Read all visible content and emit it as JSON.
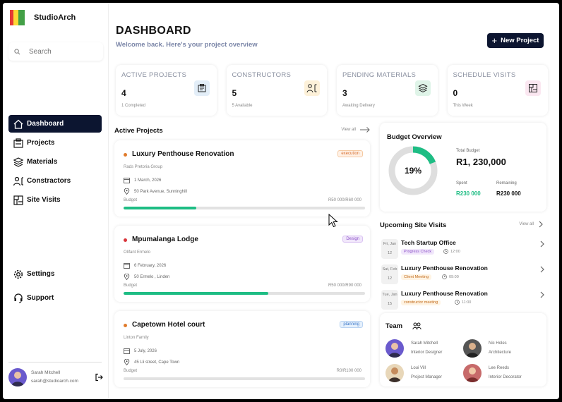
{
  "app": {
    "name": "StudioArch"
  },
  "search": {
    "placeholder": "Search"
  },
  "nav": [
    {
      "label": "Dashboard",
      "icon": "home-icon",
      "active": true
    },
    {
      "label": "Projects",
      "icon": "projects-icon"
    },
    {
      "label": "Materials",
      "icon": "layers-icon"
    },
    {
      "label": "Constractors",
      "icon": "constructor-icon"
    },
    {
      "label": "Site Visits",
      "icon": "blueprint-icon"
    }
  ],
  "footer_nav": {
    "settings": "Settings",
    "support": "Support"
  },
  "user": {
    "name": "Sarah Mitchell",
    "email": "sarah@studioarch.com"
  },
  "header": {
    "title": "DASHBOARD",
    "subtitle": "Welcome back. Here's your project overview",
    "new_button": "New Project"
  },
  "stats": [
    {
      "label": "ACTIVE PROJECTS",
      "value": "4",
      "sub": "1 Completed",
      "icon": "clipboard-icon",
      "color": "#e3eef8"
    },
    {
      "label": "CONSTRUCTORS",
      "value": "5",
      "sub": "5 Available",
      "icon": "worker-icon",
      "color": "#fdf1d9"
    },
    {
      "label": "PENDING MATERIALS",
      "value": "3",
      "sub": "Awaiting Delivery",
      "icon": "layers-icon",
      "color": "#dff4e8"
    },
    {
      "label": "SCHEDULE VISITS",
      "value": "0",
      "sub": "This Week",
      "icon": "blueprint-icon",
      "color": "#fbe7f1"
    }
  ],
  "active_projects": {
    "title": "Active Projects",
    "view_all": "View all",
    "items": [
      {
        "name": "Luxury Penthouse  Renovation",
        "tag": "execution",
        "client": "Rads Pretoria Group",
        "date": "1 March, 2026",
        "address": "50 Park Avenue, Sunninghill",
        "budget_label": "Budget",
        "amount": "R50 000/R60 000",
        "progress": 0.3,
        "dot": "#e07b2b",
        "tag_fg": "#d66a2a",
        "tag_bg": "#fff1e6"
      },
      {
        "name": "Mpumalanga Lodge",
        "tag": "Design",
        "client": "Olifant Ermelo",
        "date": "6 February, 2026",
        "address": "50 Ermelo , Linden",
        "budget_label": "Budget",
        "amount": "R50 000/R90 000",
        "progress": 0.6,
        "dot": "#d9343a",
        "tag_fg": "#8a4fc7",
        "tag_bg": "#f1e7fb"
      },
      {
        "name": "Capetown Hotel court",
        "tag": "planning",
        "client": "Linton Family",
        "date": "5 July, 2026",
        "address": "45 Lli street, Cape Town",
        "budget_label": "Budget",
        "amount": "R0/R100 000",
        "progress": 0,
        "dot": "#e07b2b",
        "tag_fg": "#3a76c9",
        "tag_bg": "#e5f0fc"
      }
    ]
  },
  "budget": {
    "title": "Budget Overview",
    "percent": "19%",
    "percent_value": 0.19,
    "total_label": "Total Budget",
    "total": "R1, 230,000",
    "spent_label": "Spent",
    "spent": "R230 000",
    "remaining_label": "Remaining",
    "remaining": "R230 000"
  },
  "visits": {
    "title": "Upcoming Site Visits",
    "view_all": "View all",
    "items": [
      {
        "day": "Fri, Jan",
        "date": "12",
        "name": "Tech Startup Office",
        "tag": "Progress Check",
        "time": "12:00",
        "tag_fg": "#8a4fc7",
        "tag_bg": "#f1e7fb"
      },
      {
        "day": "Sat, Feb",
        "date": "12",
        "name": "Luxury Penthouse  Renovation",
        "tag": "Client Meeting",
        "time": "09:00",
        "tag_fg": "#c26a1a",
        "tag_bg": "#fff4e4"
      },
      {
        "day": "Tue, Jan",
        "date": "15",
        "name": "Luxury Penthouse  Renovation",
        "tag": "constructor meeting",
        "time": "11:00",
        "tag_fg": "#c26a1a",
        "tag_bg": "#fff4e4"
      }
    ]
  },
  "team": {
    "title": "Team",
    "members": [
      {
        "name": "Sarah Mitchell",
        "role": "Interior Designer",
        "color": "#6a5acd"
      },
      {
        "name": "Nic Holes",
        "role": "Architecture",
        "color": "#444"
      },
      {
        "name": "Loui Vill",
        "role": "Project Manager",
        "color": "#c7994a"
      },
      {
        "name": "Lee Reeds",
        "role": "Interior Decorator",
        "color": "#c76a6a"
      }
    ]
  }
}
